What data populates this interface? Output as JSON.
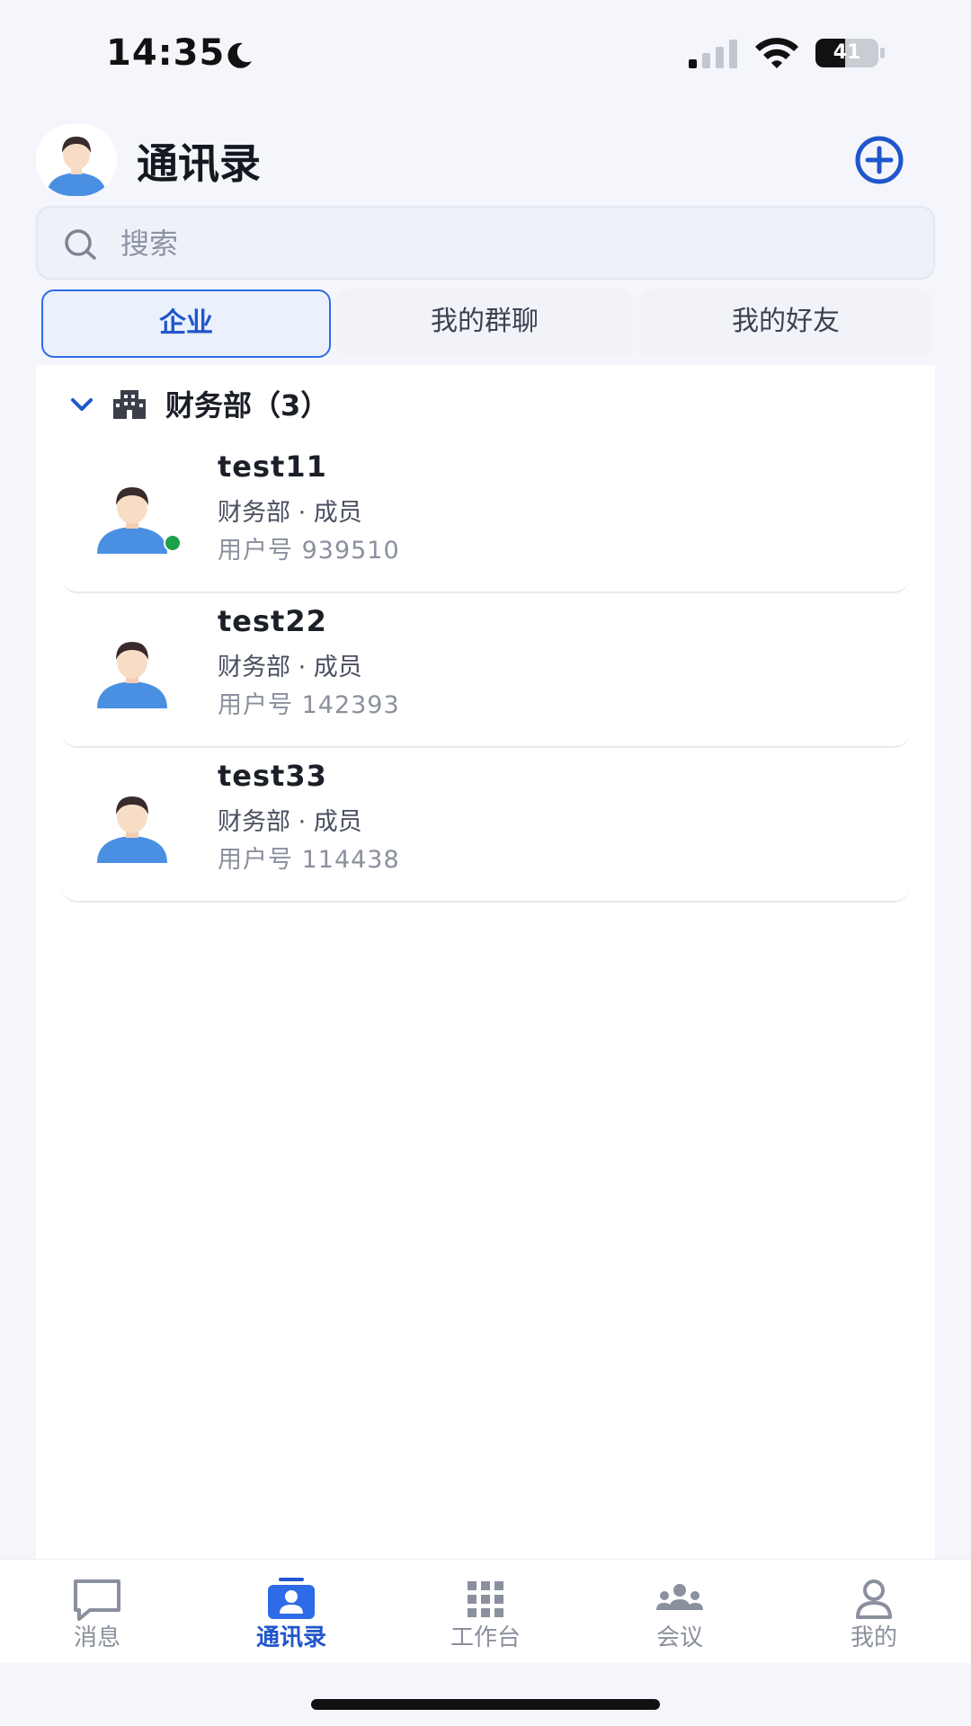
{
  "status_bar": {
    "time": "14:35",
    "battery": "41"
  },
  "header": {
    "title": "通讯录"
  },
  "search": {
    "placeholder": "搜索",
    "value": ""
  },
  "tabs": [
    {
      "label": "企业",
      "active": true
    },
    {
      "label": "我的群聊",
      "active": false
    },
    {
      "label": "我的好友",
      "active": false
    }
  ],
  "group": {
    "label": "财务部（3）"
  },
  "contacts": [
    {
      "name": "test11",
      "dept": "财务部 · 成员",
      "user_id": "用户号 939510",
      "online": true
    },
    {
      "name": "test22",
      "dept": "财务部 · 成员",
      "user_id": "用户号 142393",
      "online": false
    },
    {
      "name": "test33",
      "dept": "财务部 · 成员",
      "user_id": "用户号 114438",
      "online": false
    }
  ],
  "nav": [
    {
      "label": "消息",
      "icon": "message-icon",
      "active": false
    },
    {
      "label": "通讯录",
      "icon": "contacts-icon",
      "active": true
    },
    {
      "label": "工作台",
      "icon": "grid-icon",
      "active": false
    },
    {
      "label": "会议",
      "icon": "meeting-icon",
      "active": false
    },
    {
      "label": "我的",
      "icon": "profile-icon",
      "active": false
    }
  ],
  "colors": {
    "accent": "#2d6ce6",
    "online": "#1ca04c",
    "avatar_shirt": "#4a90e2"
  }
}
